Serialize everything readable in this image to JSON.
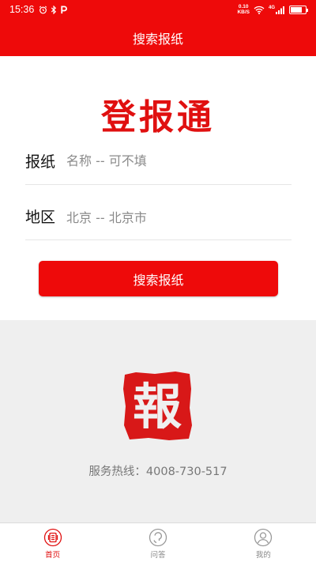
{
  "status_bar": {
    "time": "15:36",
    "network_speed_value": "0.10",
    "network_speed_unit": "KB/S",
    "signal_type": "4G",
    "battery_level": 0.8
  },
  "header": {
    "title": "搜索报纸"
  },
  "brand": {
    "logo_text": "登报通",
    "logo_color": "#e01010",
    "seal_character": "報"
  },
  "form": {
    "paper": {
      "label": "报纸",
      "placeholder": "名称 -- 可不填"
    },
    "region": {
      "label": "地区",
      "value": "北京 -- 北京市"
    },
    "search_button_label": "搜索报纸"
  },
  "footer": {
    "hotline": "服务热线：4008-730-517"
  },
  "tabs": [
    {
      "label": "首页",
      "icon": "home-icon",
      "active": true
    },
    {
      "label": "问答",
      "icon": "qa-icon",
      "active": false
    },
    {
      "label": "我的",
      "icon": "profile-icon",
      "active": false
    }
  ],
  "colors": {
    "accent": "#ee0a0a",
    "background_gray": "#efefef"
  }
}
